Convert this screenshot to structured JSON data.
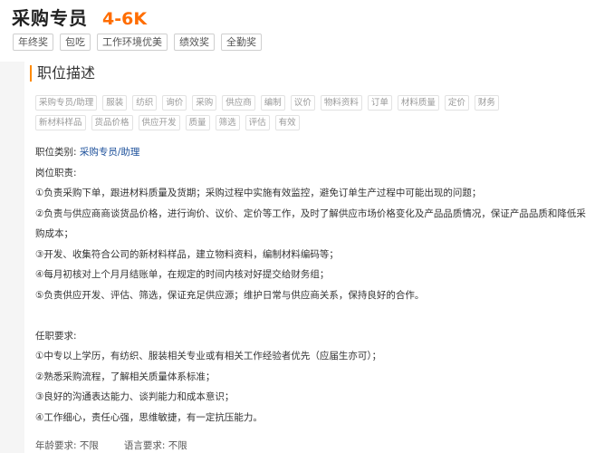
{
  "job": {
    "title": "采购专员",
    "salary": "4-6K",
    "benefits": [
      "年终奖",
      "包吃",
      "工作环境优美",
      "绩效奖",
      "全勤奖"
    ]
  },
  "section": {
    "title": "职位描述",
    "tags_row1": [
      "采购专员/助理",
      "服装",
      "纺织",
      "询价",
      "采购",
      "供应商",
      "编制",
      "议价",
      "物料资料",
      "订单",
      "材料质量",
      "定价",
      "财务"
    ],
    "tags_row2": [
      "新材料样品",
      "货品价格",
      "供应开发",
      "质量",
      "筛选",
      "评估",
      "有效"
    ]
  },
  "description": {
    "category_label": "职位类别:",
    "category_value": "采购专员/助理",
    "duties_heading": "岗位职责:",
    "duty1": "①负责采购下单，跟进材料质量及货期；采购过程中实施有效监控，避免订单生产过程中可能出现的问题；",
    "duty2a": "②负责与供应商商谈货品价格，进行询价、议价、定价等工作，及时了解供应市场价格变化及产品品质情况，保证产品品质和降低采",
    "duty2b": "购成本；",
    "duty3": "③开发、收集符合公司的新材料样品，建立物料资料，编制材料编码等；",
    "duty4": "④每月初核对上个月月结账单，在规定的时间内核对好提交给财务组；",
    "duty5": "⑤负责供应开发、评估、筛选，保证充足供应源；维护日常与供应商关系，保持良好的合作。",
    "req_heading": "任职要求:",
    "req1": "①中专以上学历，有纺织、服装相关专业或有相关工作经验者优先（应届生亦可）；",
    "req2": "②熟悉采购流程，了解相关质量体系标准；",
    "req3": "③良好的沟通表达能力、谈判能力和成本意识；",
    "req4": "④工作细心，责任心强，思维敏捷，有一定抗压能力。"
  },
  "footer": {
    "age_label": "年龄要求:",
    "age_value": "不限",
    "lang_label": "语言要求:",
    "lang_value": "不限"
  }
}
